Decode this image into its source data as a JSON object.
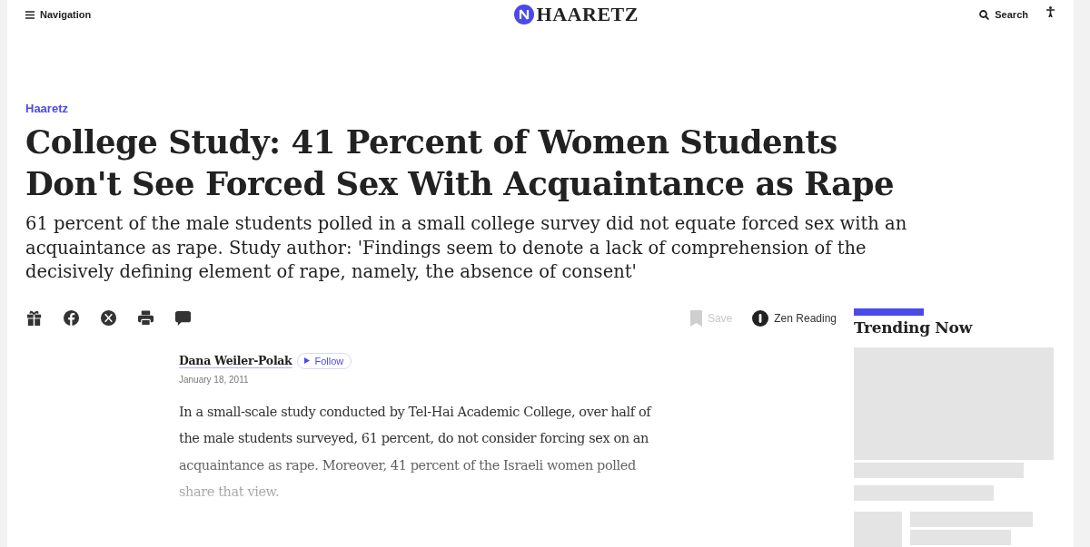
{
  "header": {
    "nav_label": "Navigation",
    "logo": "HAARETZ",
    "search_label": "Search"
  },
  "article": {
    "section": "Haaretz",
    "title": "College Study: 41 Percent of Women Students Don't See Forced Sex With Acquaintance as Rape",
    "subtitle": "61 percent of the male students polled in a small college survey did not equate forced sex with an acquaintance as rape. Study author: 'Findings seem to denote a lack of comprehension of the decisively defining element of rape, namely, the absence of consent'",
    "actions": {
      "save_label": "Save",
      "save_disabled": true,
      "zen_label": "Zen Reading"
    },
    "author": "Dana Weiler-Polak",
    "follow_label": "Follow",
    "date": "January 18, 2011",
    "body": "In a small-scale study conducted by Tel-Hai Academic College, over half of the male students surveyed, 61 percent, do not consider forcing sex on an acquaintance as rape. Moreover, 41 percent of the Israeli women polled share that view."
  },
  "sidebar": {
    "title": "Trending Now"
  }
}
